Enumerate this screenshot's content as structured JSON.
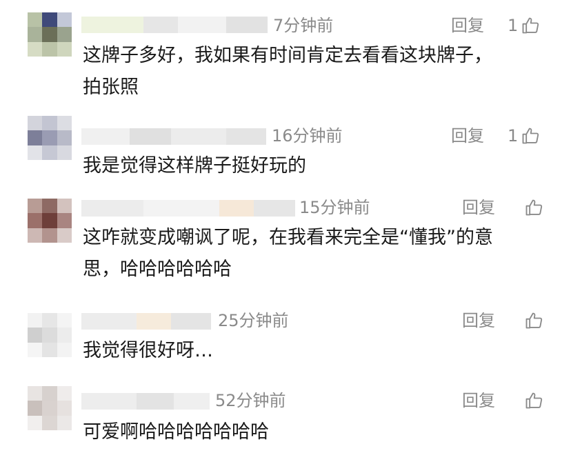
{
  "comments": [
    {
      "time": "7分钟前",
      "reply": "回复",
      "likes": "1",
      "text_lines": [
        "这牌子多好，我如果有时间肯定去看看这块牌子，",
        "拍张照"
      ]
    },
    {
      "time": "16分钟前",
      "reply": "回复",
      "likes": "1",
      "text_lines": [
        "我是觉得这样牌子挺好玩的"
      ]
    },
    {
      "time": "15分钟前",
      "reply": "回复",
      "likes": "",
      "text_lines": [
        "这咋就变成嘲讽了呢，在我看来完全是“懂我”的意",
        "思，哈哈哈哈哈哈"
      ]
    },
    {
      "time": "25分钟前",
      "reply": "回复",
      "likes": "",
      "text_lines": [
        "我觉得很好呀…"
      ]
    },
    {
      "time": "52分钟前",
      "reply": "回复",
      "likes": "",
      "text_lines": [
        "可爱啊哈哈哈哈哈哈哈"
      ]
    }
  ],
  "icons": {
    "like": "thumbs-up-icon"
  },
  "colors": {
    "meta_text": "#8a8a8a",
    "body_text": "#1a1a1a"
  }
}
